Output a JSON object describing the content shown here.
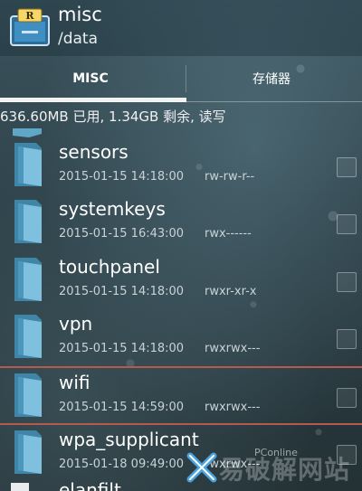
{
  "header": {
    "title": "misc",
    "subtitle": "/data"
  },
  "tabs": [
    {
      "label": "MISC",
      "active": true
    },
    {
      "label": "存储器",
      "active": false
    }
  ],
  "storage_info": "636.60MB 已用, 1.34GB 剩余, 读写",
  "files": [
    {
      "name": "sensors",
      "date": "2015-01-15 14:18:00",
      "perm": "rw-rw-r--"
    },
    {
      "name": "systemkeys",
      "date": "2015-01-15 16:43:00",
      "perm": "rwx------"
    },
    {
      "name": "touchpanel",
      "date": "2015-01-15 14:18:00",
      "perm": "rwxr-xr-x"
    },
    {
      "name": "vpn",
      "date": "2015-01-15 14:18:00",
      "perm": "rwxrwx---"
    },
    {
      "name": "wifi",
      "date": "2015-01-15 14:59:00",
      "perm": "rwxrwx---"
    },
    {
      "name": "wpa_supplicant",
      "date": "2015-01-18 09:49:00",
      "perm": "rwxrwx---"
    }
  ],
  "partial_file": {
    "name": "elanfilt"
  },
  "watermark": {
    "text": "易破解网站",
    "small": "PConline"
  },
  "colors": {
    "folder": "#5fa6c7",
    "highlight_separator": "#b45a4e",
    "tab_indicator": "#f2f2f2"
  }
}
